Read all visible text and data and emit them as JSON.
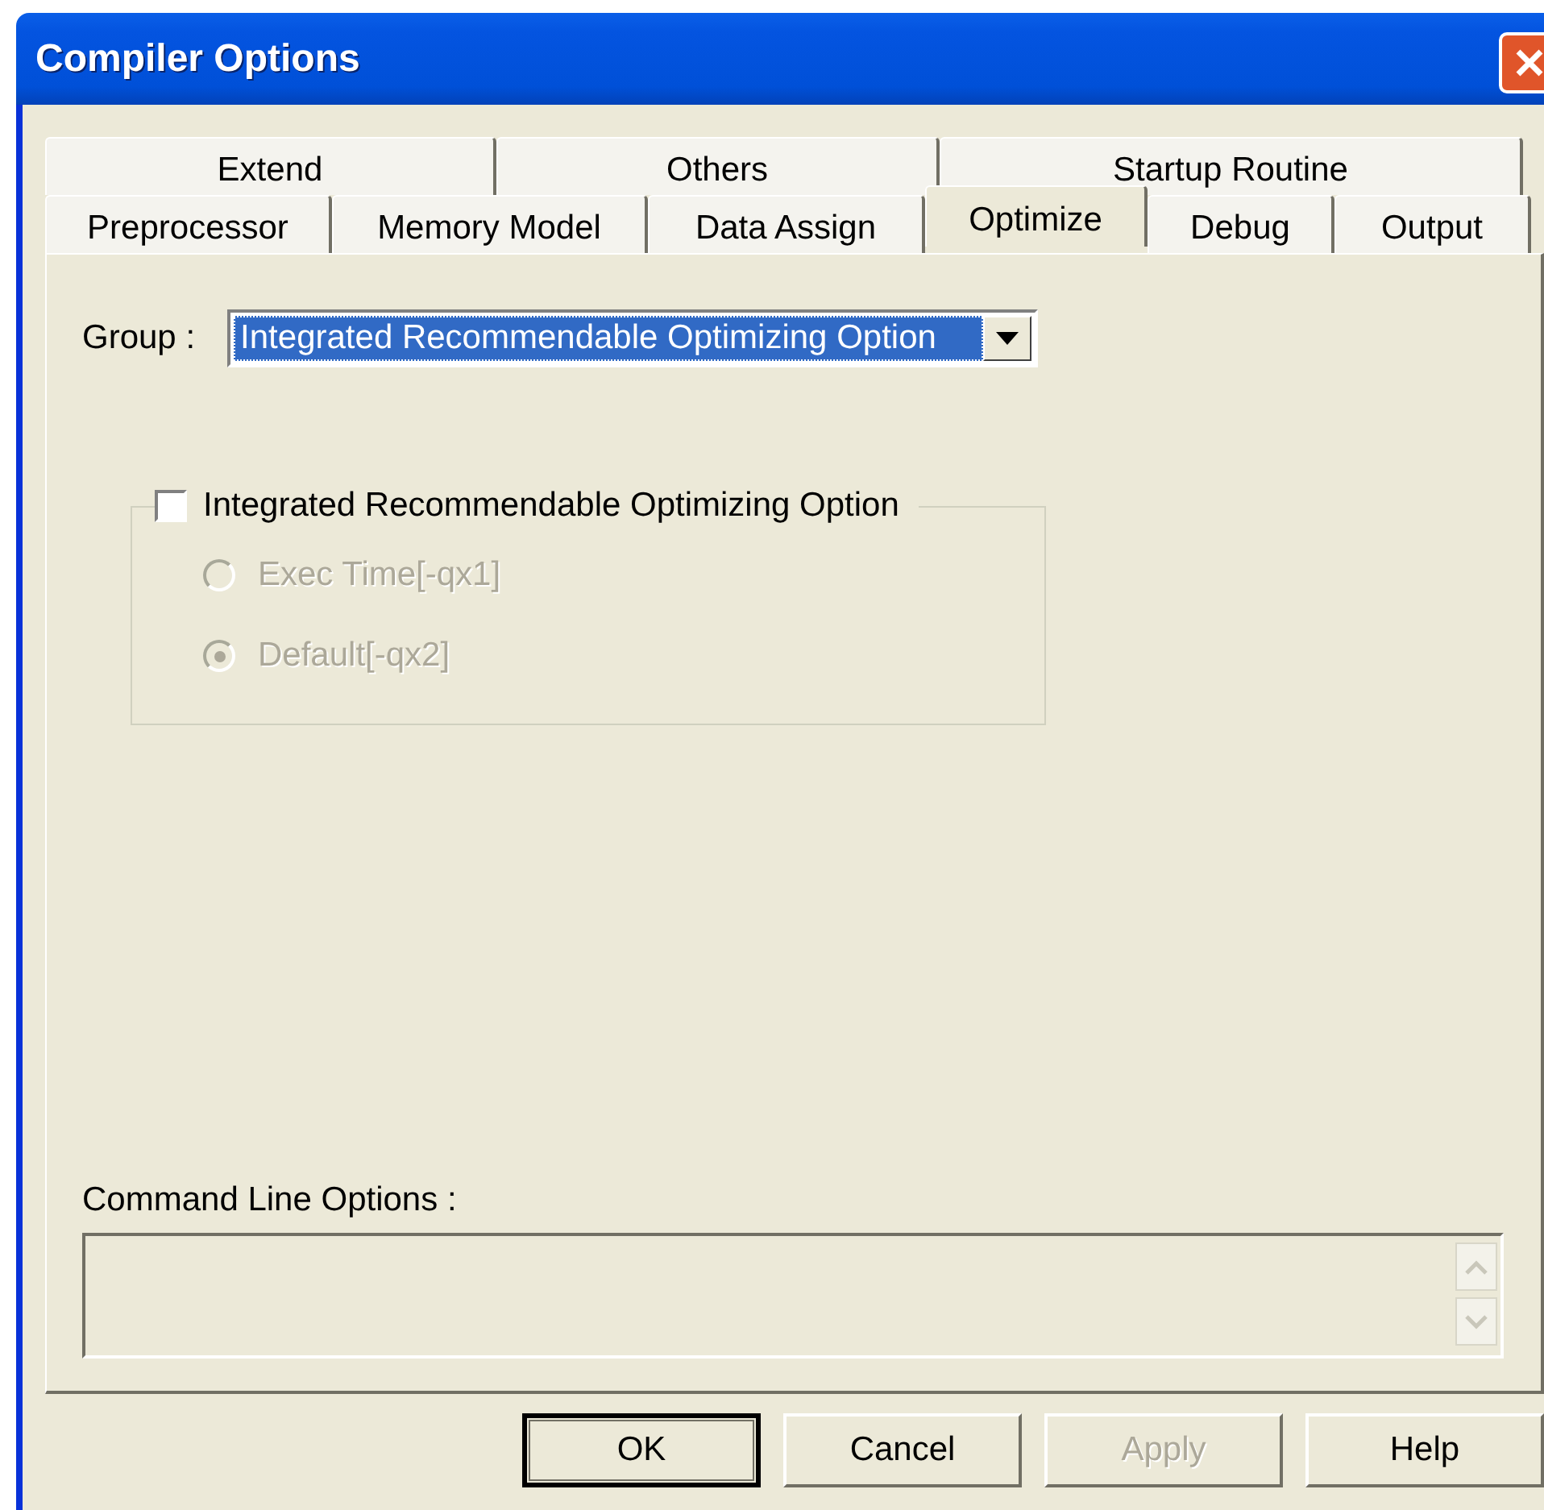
{
  "window": {
    "title": "Compiler Options"
  },
  "tabs": {
    "back_row": [
      {
        "label": "Extend",
        "selected": false
      },
      {
        "label": "Others",
        "selected": false
      },
      {
        "label": "Startup Routine",
        "selected": false
      }
    ],
    "front_row": [
      {
        "label": "Preprocessor",
        "selected": false
      },
      {
        "label": "Memory Model",
        "selected": false
      },
      {
        "label": "Data Assign",
        "selected": false
      },
      {
        "label": "Optimize",
        "selected": true
      },
      {
        "label": "Debug",
        "selected": false
      },
      {
        "label": "Output",
        "selected": false
      }
    ]
  },
  "group": {
    "label": "Group :",
    "value": "Integrated Recommendable Optimizing Option"
  },
  "option_group": {
    "label": "Integrated Recommendable Optimizing Option",
    "checked": false,
    "options": [
      {
        "label": "Exec Time[-qx1]",
        "selected": false,
        "disabled": true
      },
      {
        "label": "Default[-qx2]",
        "selected": true,
        "disabled": true
      }
    ]
  },
  "command_line": {
    "label": "Command Line Options :"
  },
  "buttons": [
    {
      "label": "OK",
      "default": true,
      "disabled": false
    },
    {
      "label": "Cancel",
      "default": false,
      "disabled": false
    },
    {
      "label": "Apply",
      "default": false,
      "disabled": true
    },
    {
      "label": "Help",
      "default": false,
      "disabled": false
    }
  ]
}
